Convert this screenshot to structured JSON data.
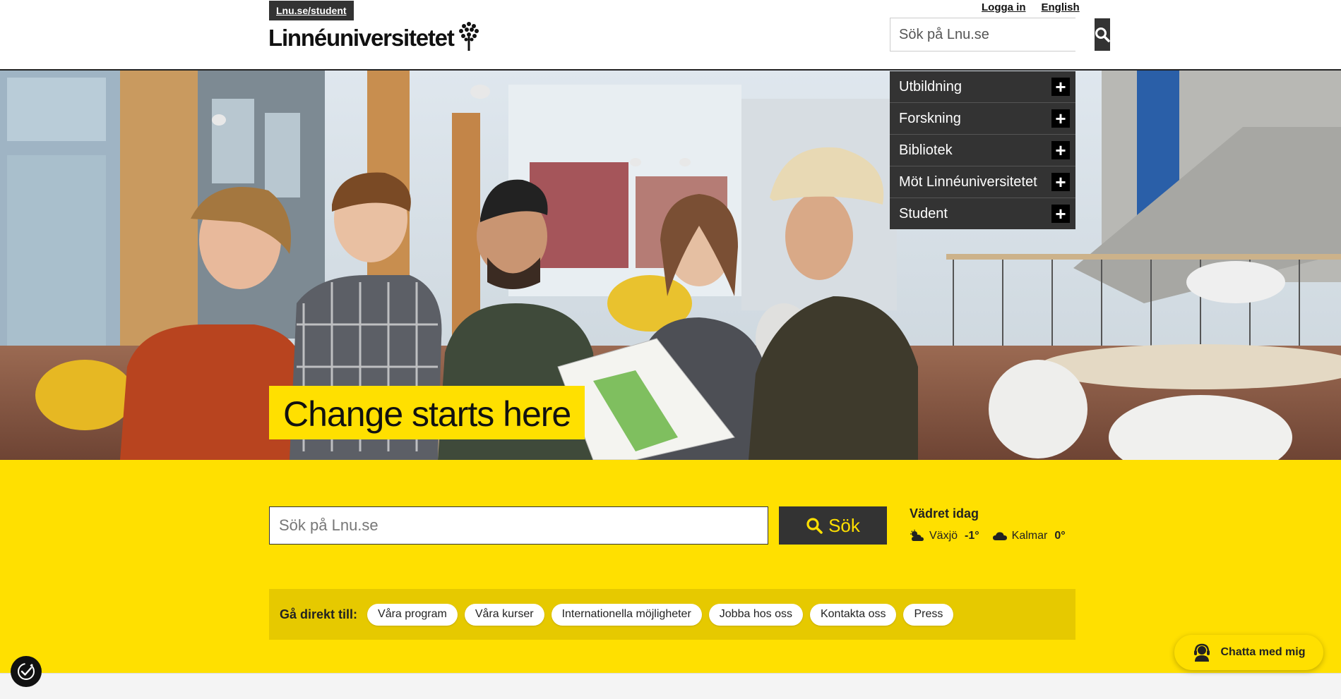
{
  "header": {
    "student_link": "Lnu.se/student",
    "logo_text": "Linnéuniversitetet",
    "login": "Logga in",
    "english": "English",
    "search_placeholder": "Sök på Lnu.se"
  },
  "menu": {
    "items": [
      {
        "label": "Utbildning"
      },
      {
        "label": "Forskning"
      },
      {
        "label": "Bibliotek"
      },
      {
        "label": "Möt Linnéuniversitetet"
      },
      {
        "label": "Student"
      }
    ],
    "expand_symbol": "+"
  },
  "hero": {
    "tagline": "Change starts here"
  },
  "search": {
    "placeholder": "Sök på Lnu.se",
    "button": "Sök"
  },
  "weather": {
    "title": "Vädret idag",
    "cities": [
      {
        "name": "Växjö",
        "temp": "-1°",
        "icon": "partly-cloudy-icon"
      },
      {
        "name": "Kalmar",
        "temp": "0°",
        "icon": "cloud-icon"
      }
    ]
  },
  "quicklinks": {
    "label": "Gå direkt till:",
    "items": [
      "Våra program",
      "Våra kurser",
      "Internationella möjligheter",
      "Jobba hos oss",
      "Kontakta oss",
      "Press"
    ]
  },
  "chat": {
    "label": "Chatta med mig"
  },
  "colors": {
    "brand_yellow": "#ffe000",
    "dark": "#333333"
  }
}
